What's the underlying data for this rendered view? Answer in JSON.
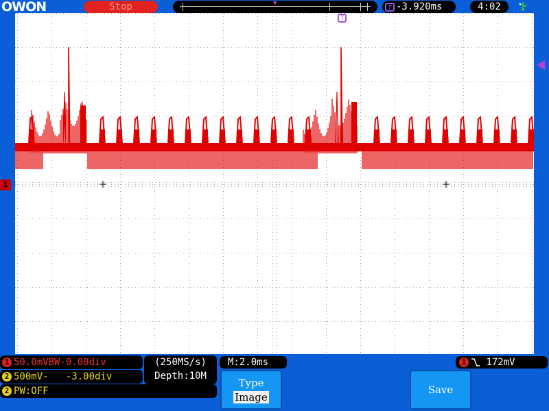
{
  "brand": "OWON",
  "status": {
    "run_state": "Stop"
  },
  "trigger": {
    "offset": "-3.920ms",
    "level": "172mV",
    "marker_label": "T",
    "channel_badge": "1"
  },
  "clock": "4:02",
  "channels": {
    "ch1": {
      "badge": "1",
      "info": "50.0mVBW-0.00div",
      "color": "#e32020"
    },
    "ch2": {
      "badge": "2",
      "info": "500mV-   -3.00div",
      "color": "#e6d21a"
    }
  },
  "pulse_width": {
    "badge": "2",
    "text": "PW:OFF"
  },
  "acquisition": {
    "sample_rate": "(250MS/s)",
    "depth": "Depth:10M"
  },
  "timebase": "M:2.0ms",
  "softkeys": {
    "type_label": "Type",
    "type_value": "Image",
    "save_label": "Save"
  },
  "icons": {
    "usb": "usb-icon",
    "edge": "rising-edge-icon"
  }
}
